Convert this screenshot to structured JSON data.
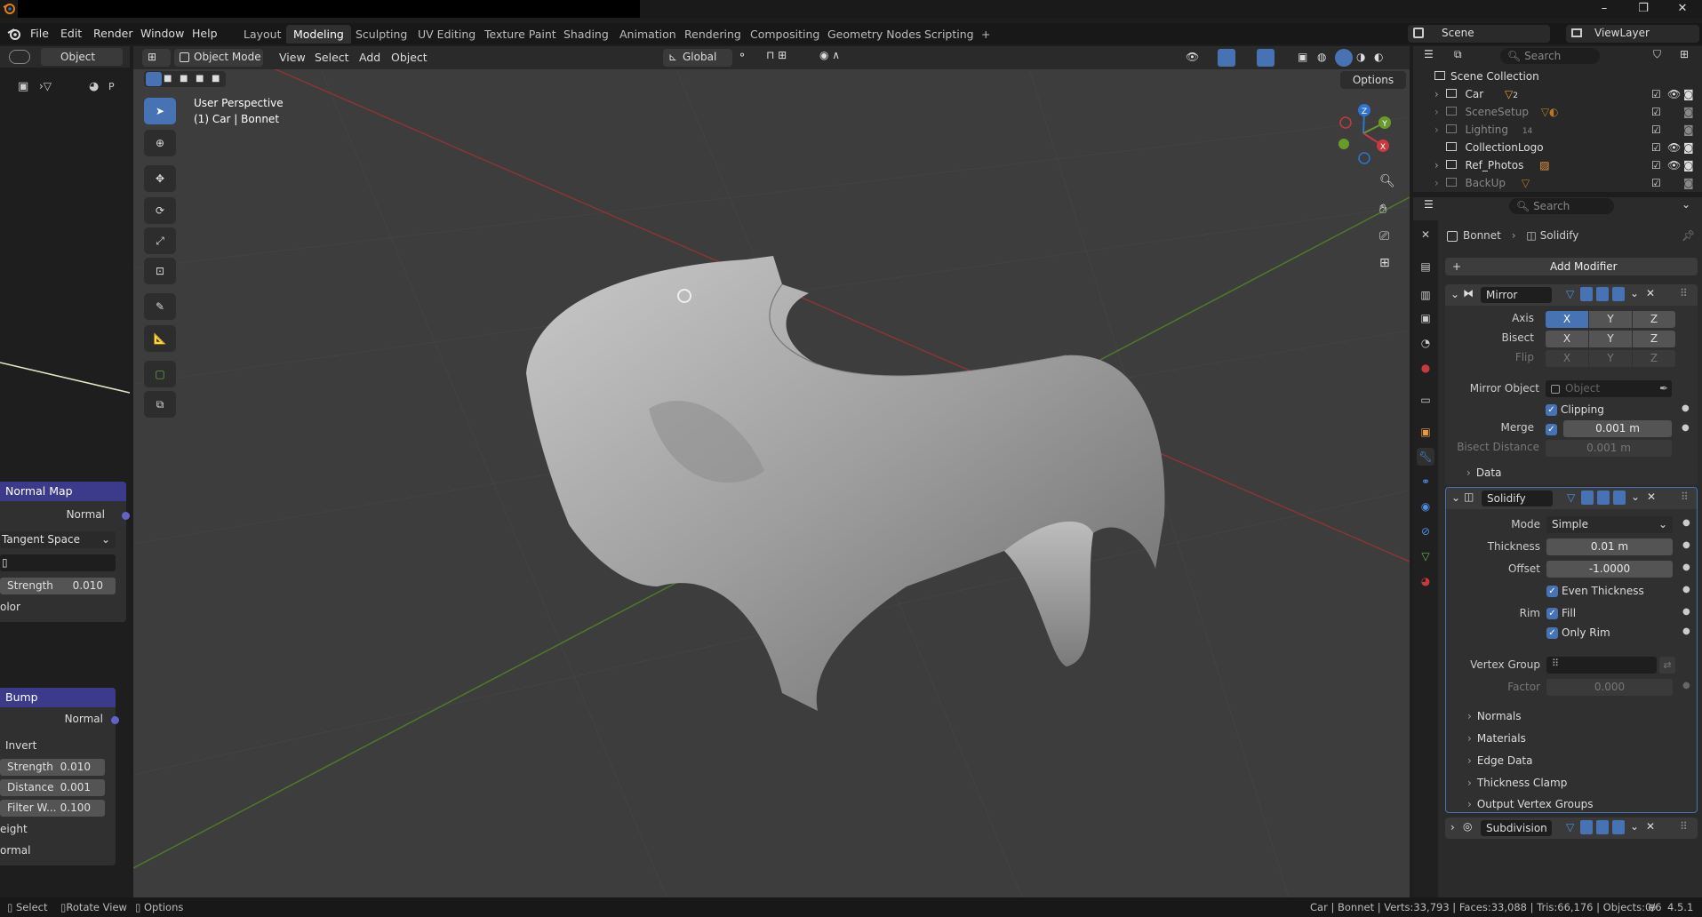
{
  "window": {
    "minimize": "–",
    "maximize": "❐",
    "close": "✕"
  },
  "menus": [
    "File",
    "Edit",
    "Render",
    "Window",
    "Help"
  ],
  "workspaces": [
    "Layout",
    "Modeling",
    "Sculpting",
    "UV Editing",
    "Texture Paint",
    "Shading",
    "Animation",
    "Rendering",
    "Compositing",
    "Geometry Nodes",
    "Scripting"
  ],
  "workspace_add": "+",
  "active_workspace": "Modeling",
  "scene": {
    "label": "Scene",
    "view_layer": "ViewLayer"
  },
  "node_header": {
    "editor": "Object",
    "p": "P"
  },
  "node_editor": {
    "normal_map": {
      "title": "Normal Map",
      "output": "Normal",
      "space": "Tangent Space",
      "strength_label": "Strength",
      "strength_value": "0.010",
      "color_label": "olor"
    },
    "bump": {
      "title": "Bump",
      "output": "Normal",
      "invert": "Invert",
      "strength_label": "Strength",
      "strength_value": "0.010",
      "distance_label": "Distance",
      "distance_value": "0.001",
      "filter_label": "Filter W...",
      "filter_value": "0.100",
      "height_label": "eight",
      "normal_label": "ormal"
    }
  },
  "viewport": {
    "mode": "Object Mode",
    "menus": [
      "View",
      "Select",
      "Add",
      "Object"
    ],
    "transform": "Global",
    "options": "Options",
    "perspective": "User Perspective",
    "context": "(1) Car | Bonnet",
    "gizmo": {
      "z": "Z",
      "y": "Y",
      "x": "X"
    }
  },
  "outliner": {
    "search_placeholder": "Search",
    "root": "Scene Collection",
    "items": [
      {
        "name": "Car",
        "dim": false,
        "badge": "2"
      },
      {
        "name": "SceneSetup",
        "dim": true,
        "badge": ""
      },
      {
        "name": "Lighting",
        "dim": true,
        "badge": "14"
      },
      {
        "name": "CollectionLogo",
        "dim": false,
        "badge": ""
      },
      {
        "name": "Ref_Photos",
        "dim": false,
        "badge": ""
      },
      {
        "name": "BackUp",
        "dim": true,
        "badge": ""
      }
    ]
  },
  "properties": {
    "search_placeholder": "Search",
    "breadcrumb_object": "Bonnet",
    "breadcrumb_modifier": "Solidify",
    "add_modifier": "Add Modifier",
    "mirror": {
      "name": "Mirror",
      "axis_label": "Axis",
      "bisect_label": "Bisect",
      "flip_label": "Flip",
      "axes": [
        "X",
        "Y",
        "Z"
      ],
      "mirror_object_label": "Mirror Object",
      "mirror_object_placeholder": "Object",
      "clipping": "Clipping",
      "merge_label": "Merge",
      "merge_value": "0.001 m",
      "bisect_distance_label": "Bisect Distance",
      "bisect_distance_value": "0.001 m",
      "data": "Data"
    },
    "solidify": {
      "name": "Solidify",
      "mode_label": "Mode",
      "mode_value": "Simple",
      "thickness_label": "Thickness",
      "thickness_value": "0.01 m",
      "offset_label": "Offset",
      "offset_value": "-1.0000",
      "even_thickness": "Even Thickness",
      "rim_label": "Rim",
      "fill": "Fill",
      "only_rim": "Only Rim",
      "vertex_group_label": "Vertex Group",
      "factor_label": "Factor",
      "factor_value": "0.000",
      "subpanels": [
        "Normals",
        "Materials",
        "Edge Data",
        "Thickness Clamp",
        "Output Vertex Groups"
      ]
    },
    "subdivision": {
      "name": "Subdivision"
    }
  },
  "statusbar": {
    "select": "Select",
    "rotate": "Rotate View",
    "options": "Options",
    "stats": "Car | Bonnet | Verts:33,793 | Faces:33,088 | Tris:66,176 | Objects:0/6",
    "version": "4.5.1"
  },
  "colors": {
    "accent": "#4772b3",
    "node_header": "#3c3b8b",
    "x_axis": "#c8383f",
    "y_axis": "#6a9a2a",
    "z_axis": "#2f74d0"
  }
}
